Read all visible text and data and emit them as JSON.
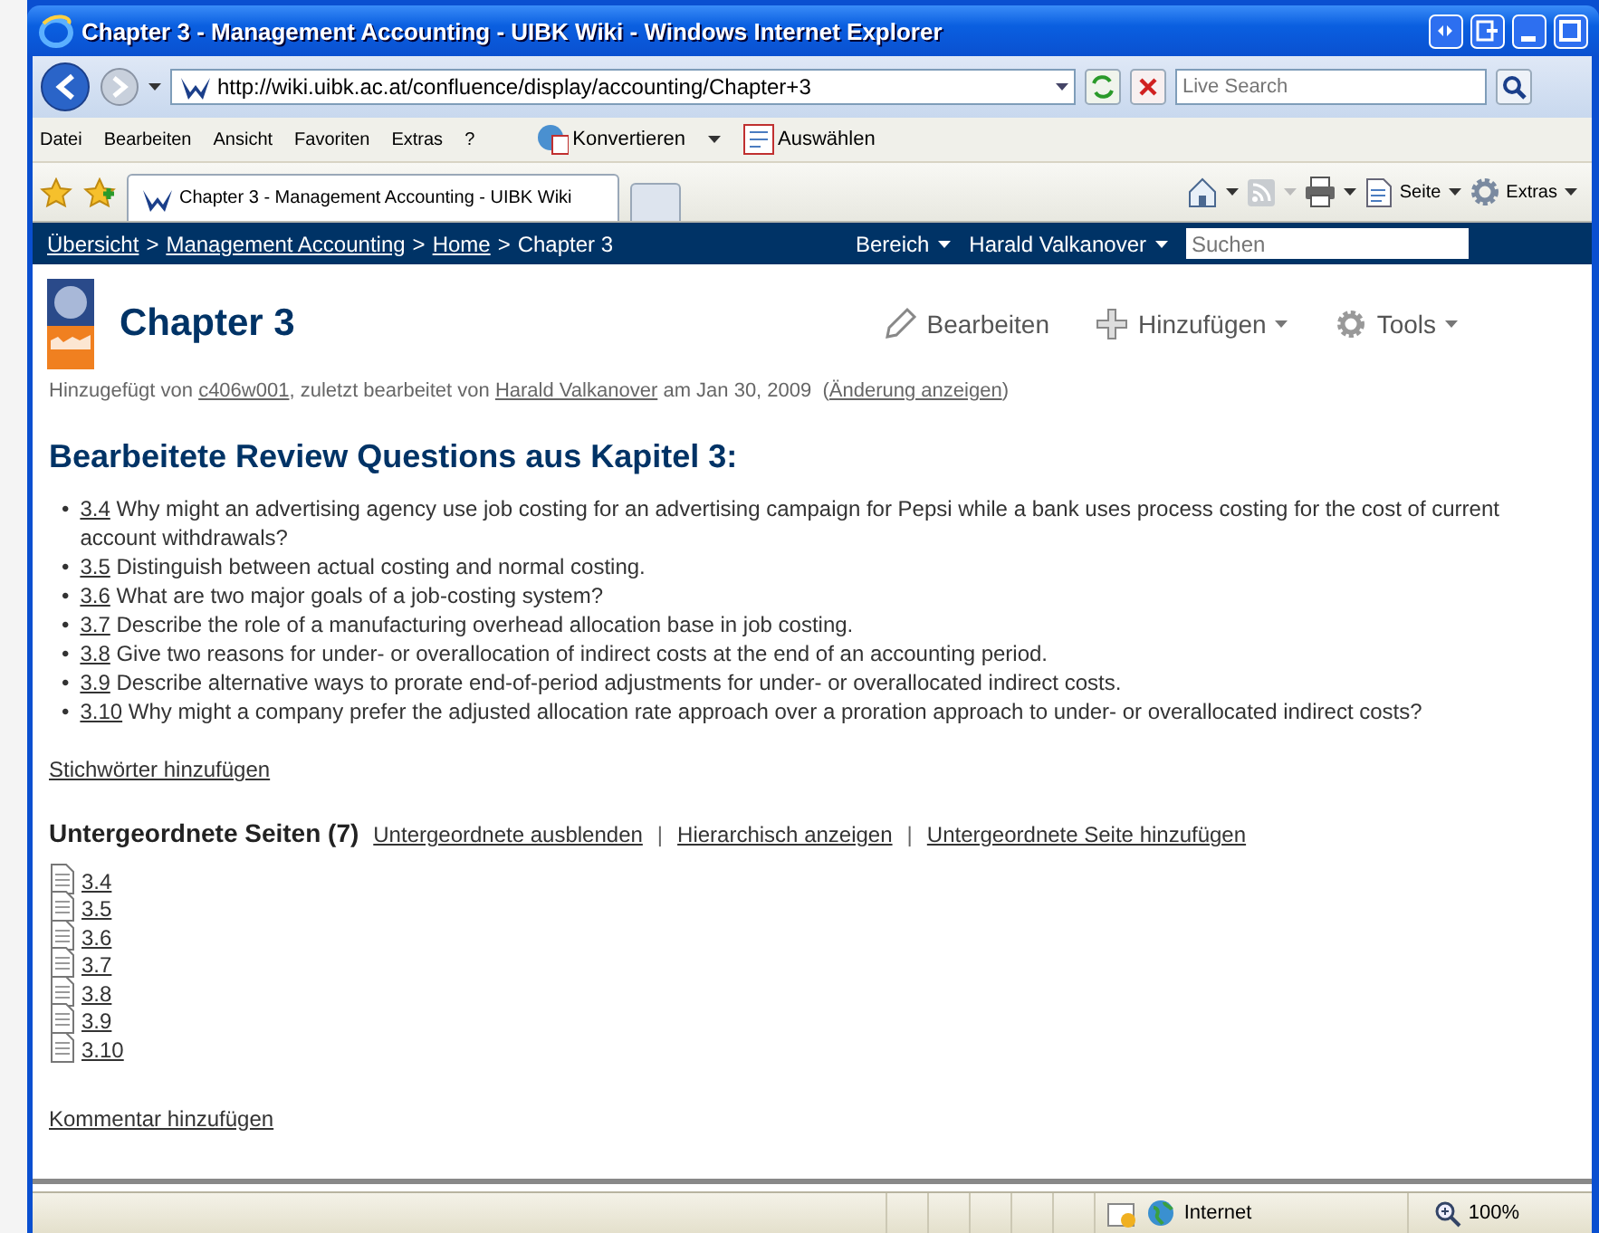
{
  "window": {
    "title": "Chapter 3 - Management Accounting - UIBK Wiki - Windows Internet Explorer"
  },
  "address_bar": {
    "url": "http://wiki.uibk.ac.at/confluence/display/accounting/Chapter+3",
    "search_placeholder": "Live Search"
  },
  "menu": [
    "Datei",
    "Bearbeiten",
    "Ansicht",
    "Favoriten",
    "Extras",
    "?"
  ],
  "toolbar_buttons": [
    "Konvertieren",
    "Auswählen"
  ],
  "tabs": [
    {
      "label": "Chapter 3 - Management Accounting - UIBK Wiki",
      "selected": true
    }
  ],
  "command_bar": [
    "Seite",
    "Extras"
  ],
  "wiki": {
    "breadcrumbs": [
      {
        "label": "Übersicht",
        "kind": "link"
      },
      {
        "label": ">",
        "kind": "text"
      },
      {
        "label": "Management Accounting",
        "kind": "link"
      },
      {
        "label": ">",
        "kind": "text"
      },
      {
        "label": "Home",
        "kind": "link"
      },
      {
        "label": ">",
        "kind": "text"
      },
      {
        "label": "Chapter 3",
        "kind": "text"
      }
    ],
    "user_menus": [
      "Bereich",
      "Harald Valkanover"
    ],
    "search_placeholder": "Suchen",
    "title": "Chapter 3",
    "actions": [
      {
        "label": "Bearbeiten",
        "kind": "edit"
      },
      {
        "label": "Hinzufügen",
        "kind": "add"
      },
      {
        "label": "Tools",
        "kind": "tools"
      }
    ],
    "meta": [
      {
        "text": "Hinzugefügt von ",
        "kind": "text"
      },
      {
        "text": "c406w001",
        "kind": "link"
      },
      {
        "text": ", zuletzt bearbeitet von ",
        "kind": "text"
      },
      {
        "text": "Harald Valkanover",
        "kind": "link"
      },
      {
        "text": " am Jan 30, 2009  (",
        "kind": "text"
      },
      {
        "text": "Änderung anzeigen",
        "kind": "link"
      },
      {
        "text": ")",
        "kind": "text"
      }
    ],
    "heading": "Bearbeitete Review Questions aus Kapitel 3:",
    "questions": [
      {
        "bullet": "•",
        "link": "3.4",
        "text": "Why might an advertising agency use job costing for an advertising campaign for Pepsi while a bank uses process costing for the cost of current account withdrawals?"
      },
      {
        "bullet": "•",
        "link": "3.5",
        "text": "Distinguish between actual costing and normal costing."
      },
      {
        "bullet": "•",
        "link": "3.6",
        "text": "What are two major goals of a job-costing system?"
      },
      {
        "bullet": "•",
        "link": "3.7",
        "text": "Describe the role of a manufacturing overhead allocation base in job costing."
      },
      {
        "bullet": "•",
        "link": "3.8",
        "text": "Give two reasons for under- or overallocation of indirect costs at the end of an accounting period."
      },
      {
        "bullet": "•",
        "link": "3.9",
        "text": "Describe alternative ways to prorate end-of-period adjustments for under- or overallocated indirect costs."
      },
      {
        "bullet": "•",
        "link": "3.10",
        "text": "Why might a company prefer the adjusted allocation rate approach over a proration approach to under- or overallocated indirect costs?"
      }
    ],
    "tags_link": "Stichwörter hinzufügen",
    "children_title": "Untergeordnete Seiten (7)",
    "children_actions": [
      "Untergeordnete ausblenden",
      "|",
      "Hierarchisch anzeigen",
      "|",
      "Untergeordnete Seite hinzufügen"
    ],
    "child_pages": [
      "3.4",
      "3.5",
      "3.6",
      "3.7",
      "3.8",
      "3.9",
      "3.10"
    ],
    "comment_link": "Kommentar hinzufügen"
  },
  "status_bar": {
    "zone": "Internet",
    "zoom": "100%"
  }
}
